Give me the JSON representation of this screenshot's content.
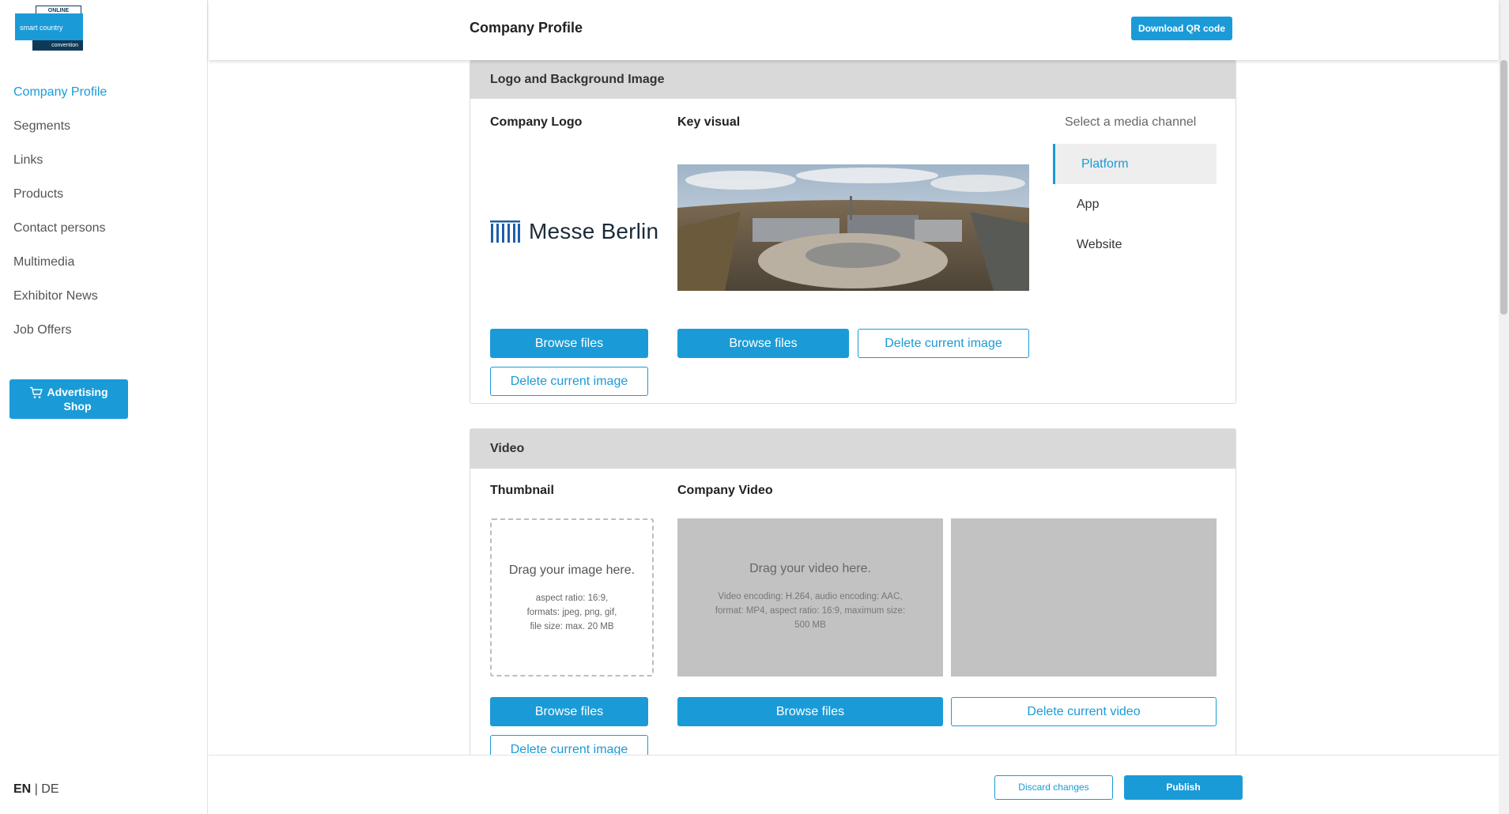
{
  "brand": {
    "logo_tag": "ONLINE",
    "logo_main": "smart country",
    "logo_sub": "convention",
    "accent": "#1a9bd7",
    "dark": "#0f3a57"
  },
  "sidebar": {
    "items": [
      {
        "label": "Company Profile",
        "active": true
      },
      {
        "label": "Segments"
      },
      {
        "label": "Links"
      },
      {
        "label": "Products"
      },
      {
        "label": "Contact persons"
      },
      {
        "label": "Multimedia"
      },
      {
        "label": "Exhibitor News"
      },
      {
        "label": "Job Offers"
      }
    ],
    "shop_line1": "Advertising",
    "shop_line2": "Shop",
    "shop_icon": "cart-icon",
    "lang_en": "EN",
    "lang_sep": "|",
    "lang_de": "DE"
  },
  "header": {
    "title": "Company Profile",
    "qr_button": "Download QR code"
  },
  "logo_section": {
    "title": "Logo and Background Image",
    "company_logo_label": "Company Logo",
    "company_logo_name": "Messe Berlin",
    "key_visual_label": "Key visual",
    "browse_files": "Browse files",
    "delete_image": "Delete current image",
    "channel_title": "Select a media channel",
    "channels": [
      "Platform",
      "App",
      "Website"
    ],
    "active_channel": "Platform"
  },
  "video_section": {
    "title": "Video",
    "thumbnail_label": "Thumbnail",
    "video_label": "Company Video",
    "image_drop_title": "Drag your image here.",
    "image_drop_info_1": "aspect ratio: 16:9,",
    "image_drop_info_2": "formats: jpeg, png, gif,",
    "image_drop_info_3": "file size: max. 20 MB",
    "video_drop_title": "Drag your video here.",
    "video_drop_info": "Video encoding: H.264, audio encoding: AAC, format: MP4, aspect ratio: 16:9, maximum size: 500 MB",
    "browse_files": "Browse files",
    "delete_image": "Delete current image",
    "delete_video": "Delete current video"
  },
  "footer": {
    "discard": "Discard changes",
    "publish": "Publish"
  }
}
